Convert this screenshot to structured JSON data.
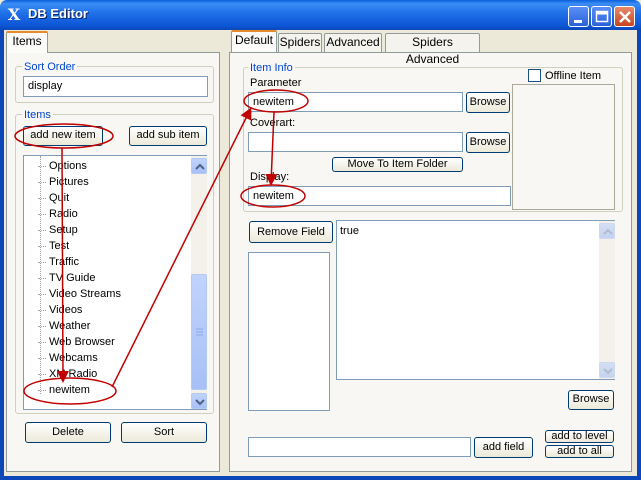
{
  "window": {
    "title": "DB Editor",
    "icon": "x-app-icon",
    "controls": [
      "minimize-icon",
      "maximize-icon",
      "close-icon"
    ]
  },
  "left": {
    "tab": "Items",
    "sort_order": {
      "legend": "Sort Order",
      "value": "display"
    },
    "items": {
      "legend": "Items",
      "add_new_item": "add new item",
      "add_sub_item": "add sub item",
      "list": [
        "Options",
        "Pictures",
        "Quit",
        "Radio",
        "Setup",
        "Test",
        "Traffic",
        "TV Guide",
        "Video Streams",
        "Videos",
        "Weather",
        "Web Browser",
        "Webcams",
        "XM Radio",
        "newitem"
      ]
    },
    "delete": "Delete",
    "sort": "Sort"
  },
  "right": {
    "tabs": [
      "Default",
      "Spiders",
      "Advanced",
      "Spiders Advanced"
    ],
    "active_tab": "Default",
    "item_info": {
      "legend": "Item Info",
      "parameter_label": "Parameter",
      "parameter_value": "newitem",
      "browse": "Browse",
      "coverart_label": "Coverart:",
      "coverart_value": "",
      "move_to_item_folder": "Move To Item Folder",
      "display_label": "Display:",
      "display_value": "newitem",
      "offline_item": "Offline Item",
      "offline_checked": false
    },
    "remove_field": "Remove Field",
    "value_text": "true",
    "browse2": "Browse",
    "field_input": "",
    "add_field": "add field",
    "add_to_level": "add to level",
    "add_to_all": "add to all"
  },
  "colors": {
    "annotation": "#c00000",
    "titlebar": "#0a5fdc",
    "legend_text": "#0046d5"
  }
}
